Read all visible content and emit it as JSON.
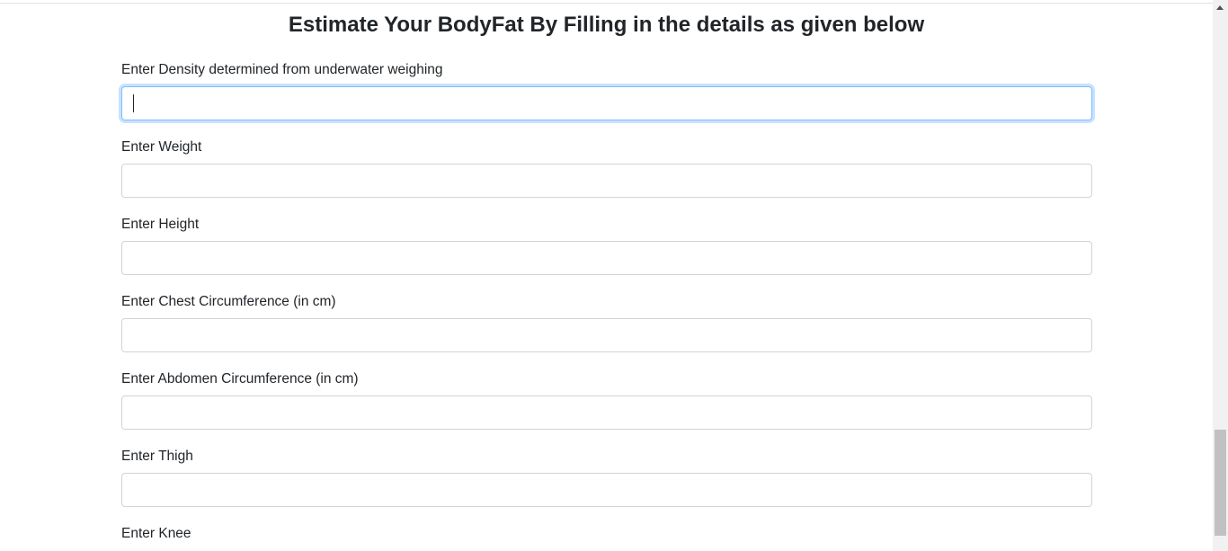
{
  "page": {
    "title": "Estimate Your BodyFat By Filling in the details as given below"
  },
  "form": {
    "fields": [
      {
        "label": "Enter Density determined from underwater weighing",
        "value": "",
        "focused": true
      },
      {
        "label": "Enter Weight",
        "value": ""
      },
      {
        "label": "Enter Height",
        "value": ""
      },
      {
        "label": "Enter Chest Circumference (in cm)",
        "value": ""
      },
      {
        "label": "Enter Abdomen Circumference (in cm)",
        "value": ""
      },
      {
        "label": "Enter Thigh",
        "value": ""
      },
      {
        "label": "Enter Knee",
        "value": ""
      }
    ]
  },
  "colors": {
    "focus_border": "#80bdff",
    "input_border": "#ced4da",
    "text": "#212529"
  },
  "scrollbar": {
    "scroll_position_fraction": 0.8
  }
}
